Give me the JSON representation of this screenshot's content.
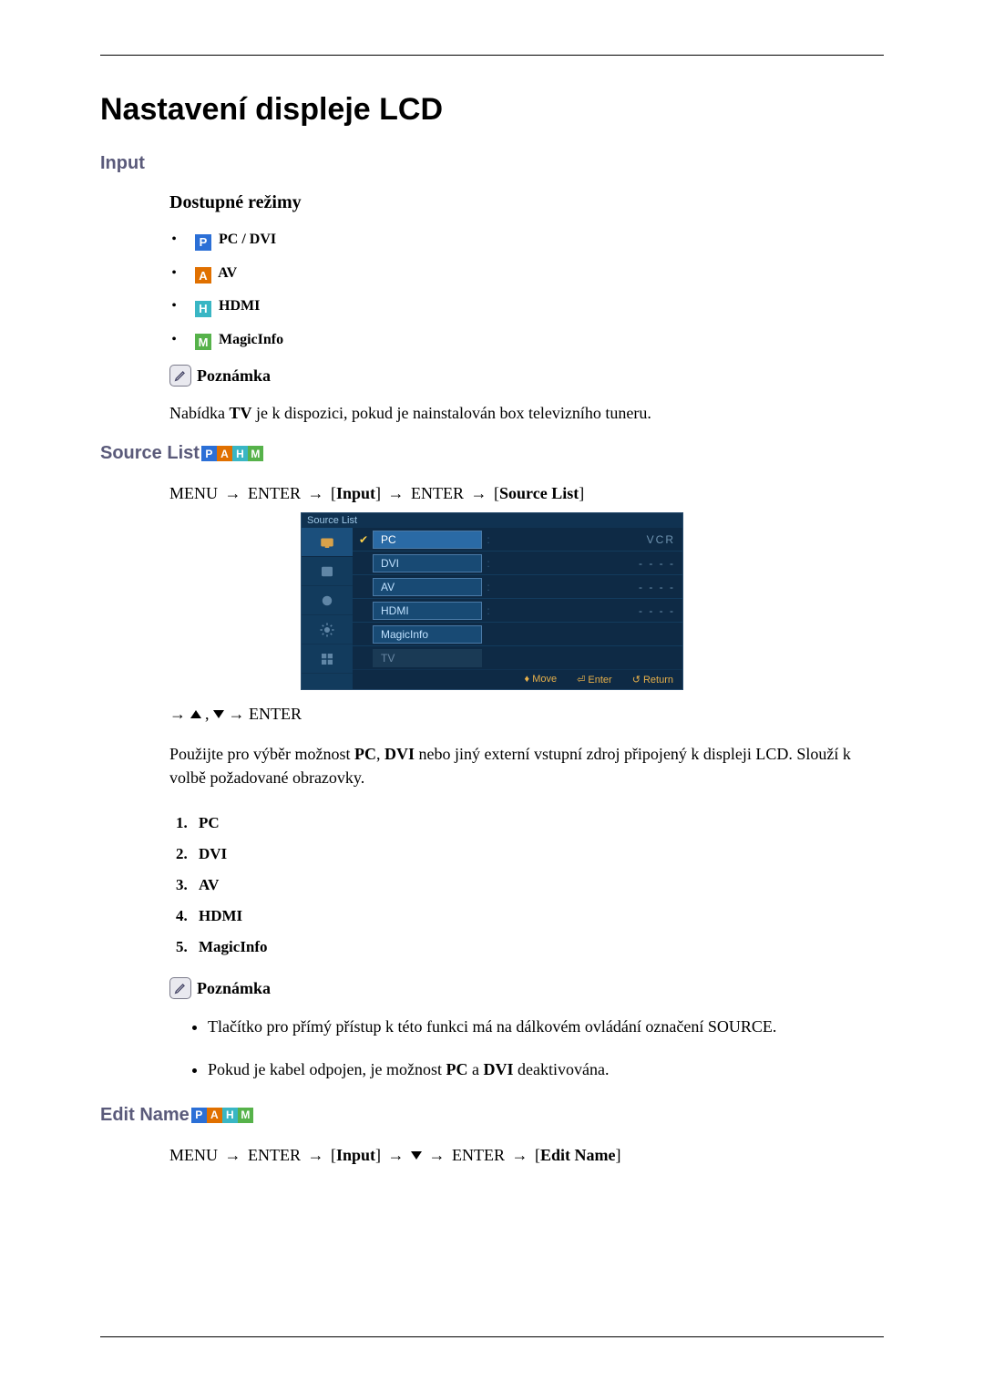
{
  "page": {
    "title": "Nastavení displeje LCD"
  },
  "sections": {
    "input": {
      "heading": "Input",
      "modes_heading": "Dostupné režimy",
      "modes": {
        "pc_dvi": "PC / DVI",
        "av": "AV",
        "hdmi": "HDMI",
        "magicinfo": "MagicInfo"
      },
      "note_label": "Poznámka",
      "note_text_pre": "Nabídka ",
      "note_text_bold": "TV",
      "note_text_post": " je k dispozici, pokud je nainstalován box televizního tuneru."
    },
    "source_list": {
      "heading": "Source List",
      "menu_path": {
        "p1": "MENU",
        "p2": "ENTER",
        "p3": "Input",
        "p4": "ENTER",
        "p5": "Source List"
      },
      "osd": {
        "title": "Source List",
        "rows": [
          {
            "checked": true,
            "label": "PC",
            "val": "VCR"
          },
          {
            "checked": false,
            "label": "DVI",
            "val": "- - - -"
          },
          {
            "checked": false,
            "label": "AV",
            "val": "- - - -"
          },
          {
            "checked": false,
            "label": "HDMI",
            "val": "- - - -"
          },
          {
            "checked": false,
            "label": "MagicInfo",
            "val": ""
          },
          {
            "checked": false,
            "label": "TV",
            "val": "",
            "dim": true
          }
        ],
        "footer": {
          "move": "Move",
          "enter": "Enter",
          "ret": "Return"
        }
      },
      "nav_hint_enter": "ENTER",
      "desc_pre": "Použijte pro výběr možnost ",
      "desc_b1": "PC",
      "desc_mid1": ", ",
      "desc_b2": "DVI",
      "desc_post": " nebo jiný externí vstupní zdroj připojený k displeji LCD. Slouží k volbě požadované obrazovky.",
      "ordered": [
        "PC",
        "DVI",
        "AV",
        "HDMI",
        "MagicInfo"
      ],
      "note_label": "Poznámka",
      "notes": {
        "n1": "Tlačítko pro přímý přístup k této funkci má na dálkovém ovládání označení SOURCE.",
        "n2_pre": "Pokud je kabel odpojen, je možnost ",
        "n2_b1": "PC",
        "n2_mid": " a ",
        "n2_b2": "DVI",
        "n2_post": " deaktivována."
      }
    },
    "edit_name": {
      "heading": "Edit Name",
      "menu_path": {
        "p1": "MENU",
        "p2": "ENTER",
        "p3": "Input",
        "p4": "ENTER",
        "p5": "Edit Name"
      }
    }
  }
}
